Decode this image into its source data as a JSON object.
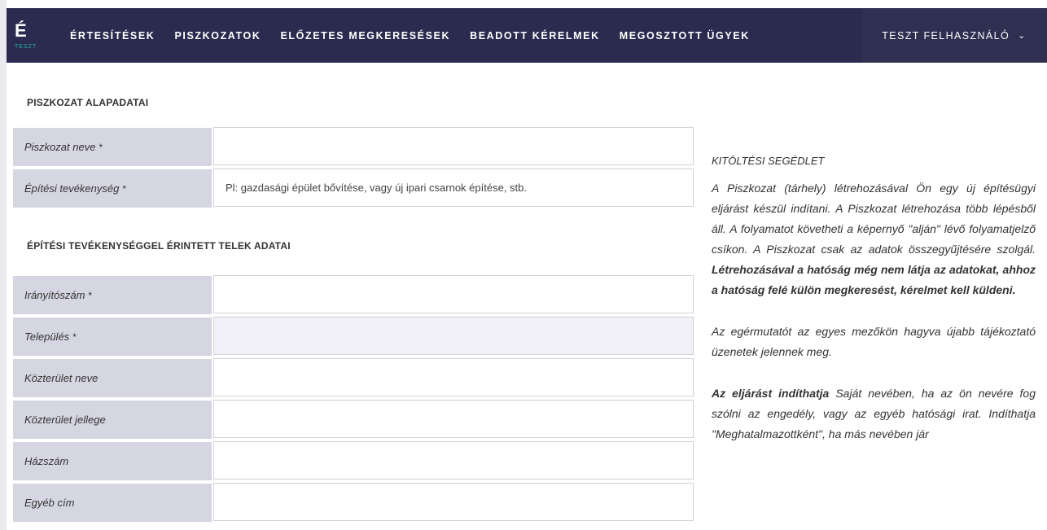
{
  "header": {
    "logo_letter": "É",
    "logo_sub": "TESZT",
    "nav": [
      "ÉRTESÍTÉSEK",
      "PISZKOZATOK",
      "ELŐZETES MEGKERESÉSEK",
      "BEADOTT KÉRELMEK",
      "MEGOSZTOTT ÜGYEK"
    ],
    "user": "TESZT FELHASZNÁLÓ",
    "user_chevron": "⌄"
  },
  "section1": {
    "title": "PISZKOZAT ALAPADATAI",
    "fields": [
      {
        "label": "Piszkozat neve",
        "required": "*",
        "value": "",
        "placeholder": ""
      },
      {
        "label": "Építési tevékenység",
        "required": "*",
        "value": "",
        "placeholder": "Pl: gazdasági épület bővítése, vagy új ipari csarnok építése, stb."
      }
    ]
  },
  "section2": {
    "title": "ÉPÍTÉSI TEVÉKENYSÉGGEL ÉRINTETT TELEK ADATAI",
    "fields": [
      {
        "label": "Irányítószám",
        "required": "*",
        "value": "",
        "placeholder": ""
      },
      {
        "label": "Település",
        "required": "*",
        "value": "",
        "placeholder": ""
      },
      {
        "label": "Közterület neve",
        "required": "",
        "value": "",
        "placeholder": ""
      },
      {
        "label": "Közterület jellege",
        "required": "",
        "value": "",
        "placeholder": ""
      },
      {
        "label": "Házszám",
        "required": "",
        "value": "",
        "placeholder": ""
      },
      {
        "label": "Egyéb cím",
        "required": "",
        "value": "",
        "placeholder": ""
      }
    ]
  },
  "help": {
    "title": "KITÖLTÉSI SEGÉDLET",
    "p1_text": "A Piszkozat (tárhely) létrehozásával Ön egy új építésügyi eljárást készül indítani. A Piszkozat létrehozása több lépésből áll. A folyamatot követheti a képernyő \"alján\" lévő folyamatjelző csíkon. A Piszkozat csak az adatok összegyűjtésére szolgál. ",
    "p1_bold": "Létrehozásával a hatóság még nem látja az adatokat, ahhoz a hatóság felé külön megkeresést, kérelmet kell küldeni.",
    "p2": "Az egérmutatót az egyes mezőkön hagyva újabb tájékoztató üzenetek jelennek meg.",
    "p3_bold": "Az eljárást indíthatja",
    "p3_text": " Saját nevében, ha az ön nevére fog szólni az engedély, vagy az egyéb hatósági irat. Indíthatja \"Meghatalmazottként\", ha más nevében jár"
  }
}
